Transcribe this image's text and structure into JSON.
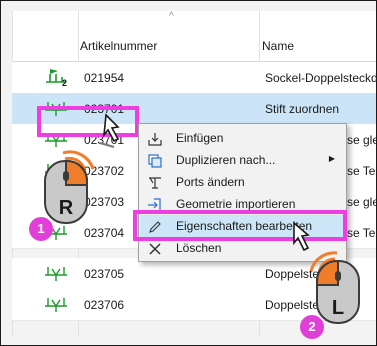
{
  "grid": {
    "sort_indicator": "^",
    "columns": {
      "article_number": "Artikelnummer",
      "name": "Name"
    },
    "rows": [
      {
        "number": "021954",
        "name": "Sockel-Doppelsteckd",
        "icon": "symbol-f2-icon",
        "badge": "2"
      },
      {
        "number": "023701",
        "name": "Stift zuordnen",
        "icon": "connector-icon",
        "selected": true
      },
      {
        "number": "023701",
        "name": "se glei",
        "icon": "connector-icon"
      },
      {
        "number": "023702",
        "name": "se Tehi",
        "icon": "connector-icon"
      },
      {
        "number": "023703",
        "name": "se glei",
        "icon": "connector-icon"
      },
      {
        "number": "023704",
        "name": "se Tehi",
        "icon": "connector-icon"
      },
      {
        "number": "023705",
        "name": "Doppelsteckdose",
        "icon": "connector-icon"
      },
      {
        "number": "023706",
        "name": "Doppelsteckdose",
        "icon": "connector-icon"
      }
    ]
  },
  "context_menu": {
    "items": [
      {
        "label": "Einfügen",
        "icon": "paste-icon"
      },
      {
        "label": "Duplizieren nach...",
        "icon": "duplicate-icon",
        "submenu": "▶"
      },
      {
        "label": "Ports ändern",
        "icon": "ports-icon"
      },
      {
        "label": "Geometrie importieren",
        "icon": "import-icon"
      },
      {
        "label": "Eigenschaften bearbeiten",
        "icon": "pencil-icon",
        "active": true
      },
      {
        "label": "Löschen",
        "icon": "close-icon"
      }
    ]
  },
  "annotations": {
    "right_mouse_letter": "R",
    "left_mouse_letter": "L",
    "step1": "1",
    "step2": "2",
    "highlight_color": "#ee3de0",
    "mouse_accent_color": "#f07d2a"
  }
}
